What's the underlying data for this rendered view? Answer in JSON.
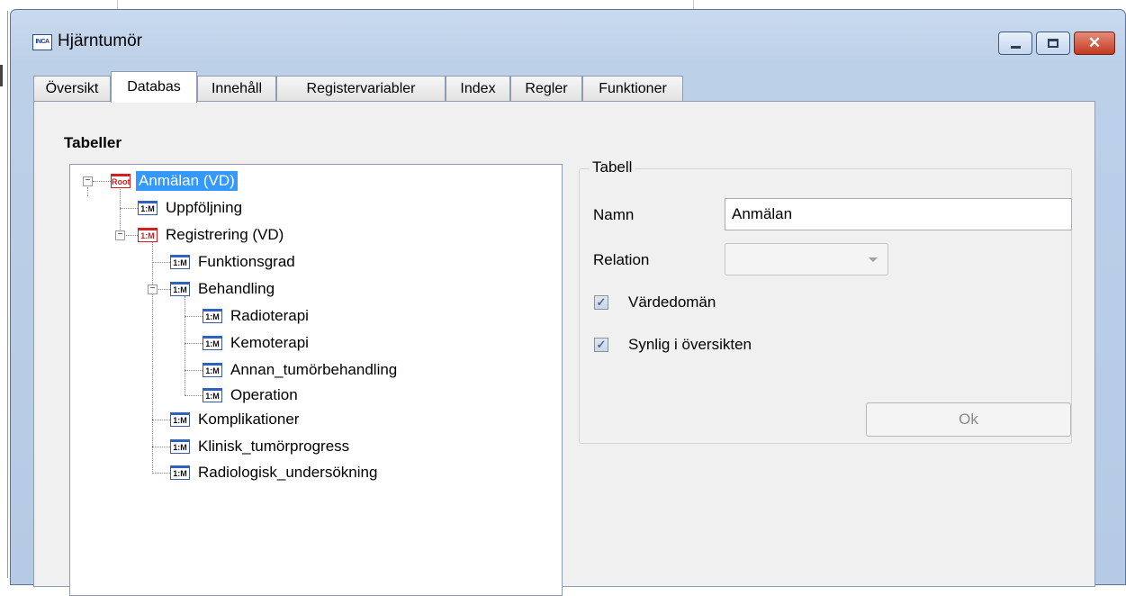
{
  "window": {
    "title": "Hjärntumör",
    "icon_name": "inca-app-icon",
    "icon_text": "INCA",
    "close_glyph": "✕"
  },
  "tabs": [
    {
      "label": "Översikt",
      "active": false
    },
    {
      "label": "Databas",
      "active": true
    },
    {
      "label": "Innehåll",
      "active": false
    },
    {
      "label": "Registervariabler",
      "active": false
    },
    {
      "label": "Index",
      "active": false
    },
    {
      "label": "Regler",
      "active": false
    },
    {
      "label": "Funktioner",
      "active": false
    }
  ],
  "tables_section": {
    "heading": "Tabeller",
    "tree": [
      {
        "label": "Anmälan (VD)",
        "icon": "Root",
        "icon_name": "root-table-icon",
        "selected": true,
        "expander": "−"
      },
      {
        "label": "Uppföljning",
        "icon": "1:M",
        "icon_name": "one-to-many-table-icon"
      },
      {
        "label": "Registrering (VD)",
        "icon": "1:M",
        "icon_name": "one-to-many-table-icon",
        "expander": "−"
      },
      {
        "label": "Funktionsgrad",
        "icon": "1:M",
        "icon_name": "one-to-many-table-icon"
      },
      {
        "label": "Behandling",
        "icon": "1:M",
        "icon_name": "one-to-many-table-icon",
        "expander": "−"
      },
      {
        "label": "Radioterapi",
        "icon": "1:M",
        "icon_name": "one-to-many-table-icon"
      },
      {
        "label": "Kemoterapi",
        "icon": "1:M",
        "icon_name": "one-to-many-table-icon"
      },
      {
        "label": "Annan_tumörbehandling",
        "icon": "1:M",
        "icon_name": "one-to-many-table-icon"
      },
      {
        "label": "Operation",
        "icon": "1:M",
        "icon_name": "one-to-many-table-icon"
      },
      {
        "label": "Komplikationer",
        "icon": "1:M",
        "icon_name": "one-to-many-table-icon"
      },
      {
        "label": "Klinisk_tumörprogress",
        "icon": "1:M",
        "icon_name": "one-to-many-table-icon"
      },
      {
        "label": "Radiologisk_undersökning",
        "icon": "1:M",
        "icon_name": "one-to-many-table-icon"
      }
    ]
  },
  "table_panel": {
    "group_title": "Tabell",
    "name_label": "Namn",
    "name_value": "Anmälan",
    "relation_label": "Relation",
    "relation_value": "",
    "checkbox_vardedoman": {
      "label": "Värdedomän",
      "checked": true,
      "mark": "✓"
    },
    "checkbox_synlig": {
      "label": "Synlig i översikten",
      "checked": true,
      "mark": "✓"
    },
    "ok_label": "Ok"
  },
  "colors": {
    "selection": "#3399ff",
    "window_frame": "#b5cae4",
    "close_button": "#c3391f"
  }
}
